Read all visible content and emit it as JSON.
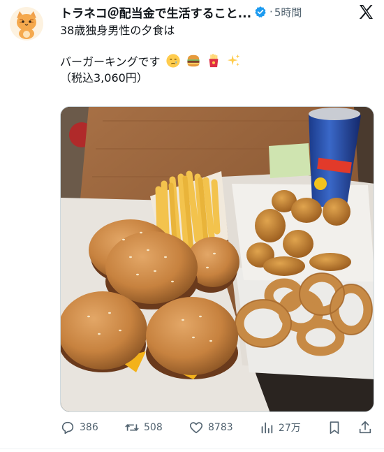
{
  "author": {
    "name": "トラネコ＠配当金で生活すること...",
    "time": "5時間",
    "time_sep": "·"
  },
  "tweet": {
    "line1": "38歳独身男性の夕食は",
    "line2": "バーガーキングです",
    "line3": "（税込3,060円）",
    "emojis": [
      "crying-face",
      "hamburger",
      "french-fries",
      "sparkles"
    ]
  },
  "stats": {
    "replies": "386",
    "retweets": "508",
    "likes": "8783",
    "views": "27万"
  },
  "colors": {
    "verified": "#1d9bf0",
    "muted": "#536471"
  }
}
